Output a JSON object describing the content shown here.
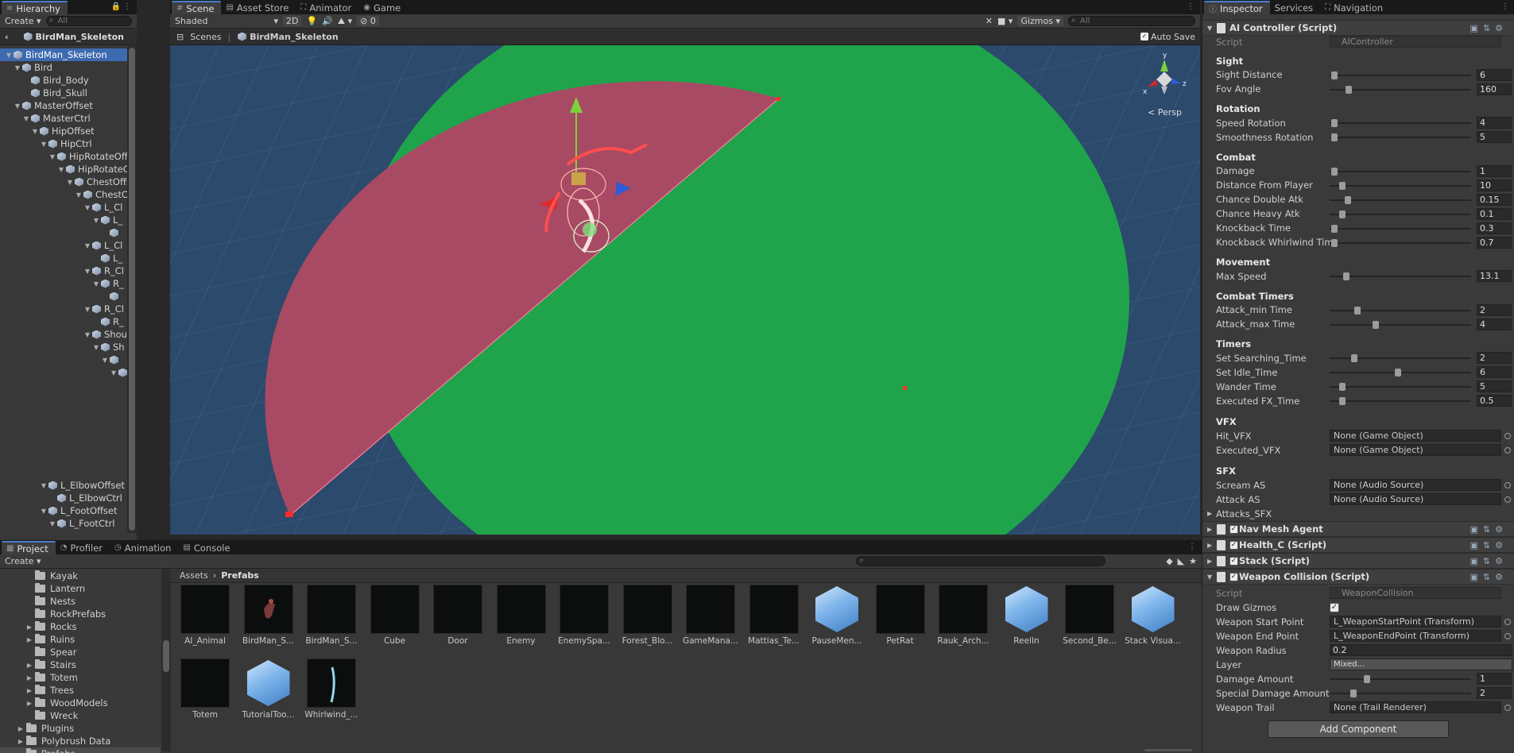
{
  "hierarchy": {
    "tab": "Hierarchy",
    "create": "Create",
    "search": "All",
    "scene_title": "BirdMan_Skeleton",
    "rows": [
      {
        "label": "BirdMan_Skeleton",
        "indent": 0,
        "arrow": "▼",
        "sel": true
      },
      {
        "label": "Bird",
        "indent": 1,
        "arrow": "▼"
      },
      {
        "label": "Bird_Body",
        "indent": 2,
        "arrow": ""
      },
      {
        "label": "Bird_Skull",
        "indent": 2,
        "arrow": ""
      },
      {
        "label": "MasterOffset",
        "indent": 1,
        "arrow": "▼"
      },
      {
        "label": "MasterCtrl",
        "indent": 2,
        "arrow": "▼"
      },
      {
        "label": "HipOffset",
        "indent": 3,
        "arrow": "▼"
      },
      {
        "label": "HipCtrl",
        "indent": 4,
        "arrow": "▼"
      },
      {
        "label": "HipRotateOffset",
        "indent": 5,
        "arrow": "▼"
      },
      {
        "label": "HipRotateCtrl",
        "indent": 6,
        "arrow": "▼"
      },
      {
        "label": "ChestOffset",
        "indent": 7,
        "arrow": "▼"
      },
      {
        "label": "ChestCtrl",
        "indent": 8,
        "arrow": "▼"
      },
      {
        "label": "L_Cl",
        "indent": 9,
        "arrow": "▼"
      },
      {
        "label": "L_",
        "indent": 10,
        "arrow": "▼"
      },
      {
        "label": "",
        "indent": 11,
        "arrow": ""
      },
      {
        "label": "L_Cl",
        "indent": 9,
        "arrow": "▼"
      },
      {
        "label": "L_",
        "indent": 10,
        "arrow": ""
      },
      {
        "label": "R_Cl",
        "indent": 9,
        "arrow": "▼"
      },
      {
        "label": "R_",
        "indent": 10,
        "arrow": "▼"
      },
      {
        "label": "",
        "indent": 11,
        "arrow": ""
      },
      {
        "label": "R_Cl",
        "indent": 9,
        "arrow": "▼"
      },
      {
        "label": "R_",
        "indent": 10,
        "arrow": ""
      },
      {
        "label": "Shou",
        "indent": 9,
        "arrow": "▼"
      },
      {
        "label": "Sh",
        "indent": 10,
        "arrow": "▼"
      },
      {
        "label": "",
        "indent": 11,
        "arrow": "▼"
      },
      {
        "label": "",
        "indent": 12,
        "arrow": "▼"
      }
    ],
    "rows_bottom": [
      {
        "label": "L_ElbowOffset",
        "indent": 4,
        "arrow": "▼"
      },
      {
        "label": "L_ElbowCtrl",
        "indent": 5,
        "arrow": ""
      },
      {
        "label": "L_FootOffset",
        "indent": 4,
        "arrow": "▼"
      },
      {
        "label": "L_FootCtrl",
        "indent": 5,
        "arrow": "▼"
      }
    ]
  },
  "scene": {
    "tabs": [
      {
        "label": "Scene",
        "icon": "#",
        "active": true
      },
      {
        "label": "Asset Store",
        "icon": "▤"
      },
      {
        "label": "Animator",
        "icon": "⛶"
      },
      {
        "label": "Game",
        "icon": "◉"
      }
    ],
    "shading": "Shaded",
    "mode_2d": "2D",
    "fx_count": "0",
    "gizmos": "Gizmos",
    "search": "All",
    "crumb_root": "Scenes",
    "crumb_item": "BirdMan_Skeleton",
    "autosave": "Auto Save",
    "persp": "Persp",
    "axes": {
      "y": "y",
      "x": "x",
      "z": "z"
    }
  },
  "project": {
    "tabs": [
      {
        "label": "Project",
        "icon": "▦",
        "active": true
      },
      {
        "label": "Profiler",
        "icon": "◔"
      },
      {
        "label": "Animation",
        "icon": "◷"
      },
      {
        "label": "Console",
        "icon": "▤"
      }
    ],
    "create": "Create",
    "folders": [
      {
        "label": "Kayak",
        "indent": 2,
        "arrow": ""
      },
      {
        "label": "Lantern",
        "indent": 2,
        "arrow": ""
      },
      {
        "label": "Nests",
        "indent": 2,
        "arrow": ""
      },
      {
        "label": "RockPrefabs",
        "indent": 2,
        "arrow": ""
      },
      {
        "label": "Rocks",
        "indent": 2,
        "arrow": "▶"
      },
      {
        "label": "Ruins",
        "indent": 2,
        "arrow": "▶"
      },
      {
        "label": "Spear",
        "indent": 2,
        "arrow": ""
      },
      {
        "label": "Stairs",
        "indent": 2,
        "arrow": "▶"
      },
      {
        "label": "Totem",
        "indent": 2,
        "arrow": "▶"
      },
      {
        "label": "Trees",
        "indent": 2,
        "arrow": "▶"
      },
      {
        "label": "WoodModels",
        "indent": 2,
        "arrow": "▶"
      },
      {
        "label": "Wreck",
        "indent": 2,
        "arrow": ""
      },
      {
        "label": "Plugins",
        "indent": 1,
        "arrow": "▶"
      },
      {
        "label": "Polybrush Data",
        "indent": 1,
        "arrow": "▶"
      },
      {
        "label": "Prefabs",
        "indent": 1,
        "arrow": "",
        "sel": true
      }
    ],
    "crumb_root": "Assets",
    "crumb_item": "Prefabs",
    "assets": [
      {
        "label": "AI_Animal",
        "kind": "dark"
      },
      {
        "label": "BirdMan_S...",
        "kind": "bird"
      },
      {
        "label": "BirdMan_S...",
        "kind": "dark"
      },
      {
        "label": "Cube",
        "kind": "dark"
      },
      {
        "label": "Door",
        "kind": "dark"
      },
      {
        "label": "Enemy",
        "kind": "dark"
      },
      {
        "label": "EnemySpa...",
        "kind": "dark"
      },
      {
        "label": "Forest_Blo...",
        "kind": "dark"
      },
      {
        "label": "GameMana...",
        "kind": "dark"
      },
      {
        "label": "Mattias_Te...",
        "kind": "dark"
      },
      {
        "label": "PauseMen...",
        "kind": "cube"
      },
      {
        "label": "PetRat",
        "kind": "dark"
      },
      {
        "label": "Rauk_Arch...",
        "kind": "dark"
      },
      {
        "label": "ReelIn",
        "kind": "cube"
      },
      {
        "label": "Second_Be...",
        "kind": "dark"
      },
      {
        "label": "Stack Visua...",
        "kind": "cube"
      },
      {
        "label": "Totem",
        "kind": "dark"
      },
      {
        "label": "TutorialToo...",
        "kind": "cube"
      },
      {
        "label": "Whirlwind_...",
        "kind": "whirl"
      }
    ]
  },
  "inspector": {
    "tabs": [
      {
        "label": "Inspector",
        "icon": "ⓘ",
        "active": true
      },
      {
        "label": "Services",
        "icon": ""
      },
      {
        "label": "Navigation",
        "icon": "⛶"
      }
    ],
    "ai": {
      "title": "AI Controller (Script)",
      "script_label": "Script",
      "script_value": "AIController",
      "groups": [
        {
          "header": "Sight",
          "fields": [
            {
              "label": "Sight Distance",
              "value": "6",
              "knob": 0.01
            },
            {
              "label": "Fov Angle",
              "value": "160",
              "knob": 0.12
            }
          ]
        },
        {
          "header": "Rotation",
          "fields": [
            {
              "label": "Speed Rotation",
              "value": "4",
              "knob": 0.01
            },
            {
              "label": "Smoothness Rotation",
              "value": "5",
              "knob": 0.01
            }
          ]
        },
        {
          "header": "Combat",
          "fields": [
            {
              "label": "Damage",
              "value": "1",
              "knob": 0.01
            },
            {
              "label": "Distance From Player",
              "value": "10",
              "knob": 0.07
            },
            {
              "label": "Chance Double Atk",
              "value": "0.15",
              "knob": 0.11
            },
            {
              "label": "Chance Heavy Atk",
              "value": "0.1",
              "knob": 0.07
            },
            {
              "label": "Knockback Time",
              "value": "0.3",
              "knob": 0.01
            },
            {
              "label": "Knockback Whirlwind Time",
              "value": "0.7",
              "knob": 0.01
            }
          ]
        },
        {
          "header": "Movement",
          "fields": [
            {
              "label": "Max Speed",
              "value": "13.1",
              "knob": 0.1
            }
          ]
        },
        {
          "header": "Combat Timers",
          "fields": [
            {
              "label": "Attack_min Time",
              "value": "2",
              "knob": 0.18
            },
            {
              "label": "Attack_max Time",
              "value": "4",
              "knob": 0.32
            }
          ]
        },
        {
          "header": "Timers",
          "fields": [
            {
              "label": "Set Searching_Time",
              "value": "2",
              "knob": 0.16
            },
            {
              "label": "Set Idle_Time",
              "value": "6",
              "knob": 0.48
            },
            {
              "label": "Wander Time",
              "value": "5",
              "knob": 0.07
            },
            {
              "label": "Executed FX_Time",
              "value": "0.5",
              "knob": 0.07
            }
          ]
        }
      ],
      "vfx_header": "VFX",
      "vfx": [
        {
          "label": "Hit_VFX",
          "value": "None (Game Object)"
        },
        {
          "label": "Executed_VFX",
          "value": "None (Game Object)"
        }
      ],
      "sfx_header": "SFX",
      "sfx": [
        {
          "label": "Scream AS",
          "value": "None (Audio Source)"
        },
        {
          "label": "Attack AS",
          "value": "None (Audio Source)"
        }
      ],
      "attacks": "Attacks_SFX"
    },
    "components": [
      {
        "label": "Nav Mesh Agent"
      },
      {
        "label": "Health_C (Script)"
      },
      {
        "label": "Stack (Script)"
      }
    ],
    "weapon": {
      "title": "Weapon Collision (Script)",
      "script_label": "Script",
      "script_value": "WeaponCollision",
      "draw_gizmos": "Draw Gizmos",
      "start_label": "Weapon Start Point",
      "start_value": "L_WeaponStartPoint (Transform)",
      "end_label": "Weapon End Point",
      "end_value": "L_WeaponEndPoint (Transform)",
      "radius_label": "Weapon Radius",
      "radius_value": "0.2",
      "layer_label": "Layer",
      "layer_value": "Mixed...",
      "dmg_label": "Damage Amount",
      "dmg_value": "1",
      "dmg_knob": 0.25,
      "sdmg_label": "Special Damage Amount",
      "sdmg_value": "2",
      "sdmg_knob": 0.15,
      "trail_label": "Weapon Trail",
      "trail_value": "None (Trail Renderer)"
    },
    "add_component": "Add Component"
  },
  "colors": {
    "accent": "#3d6ab0",
    "fov_red": "#a84a63",
    "fov_green": "#1fa44c",
    "sky": "#2a4868"
  }
}
